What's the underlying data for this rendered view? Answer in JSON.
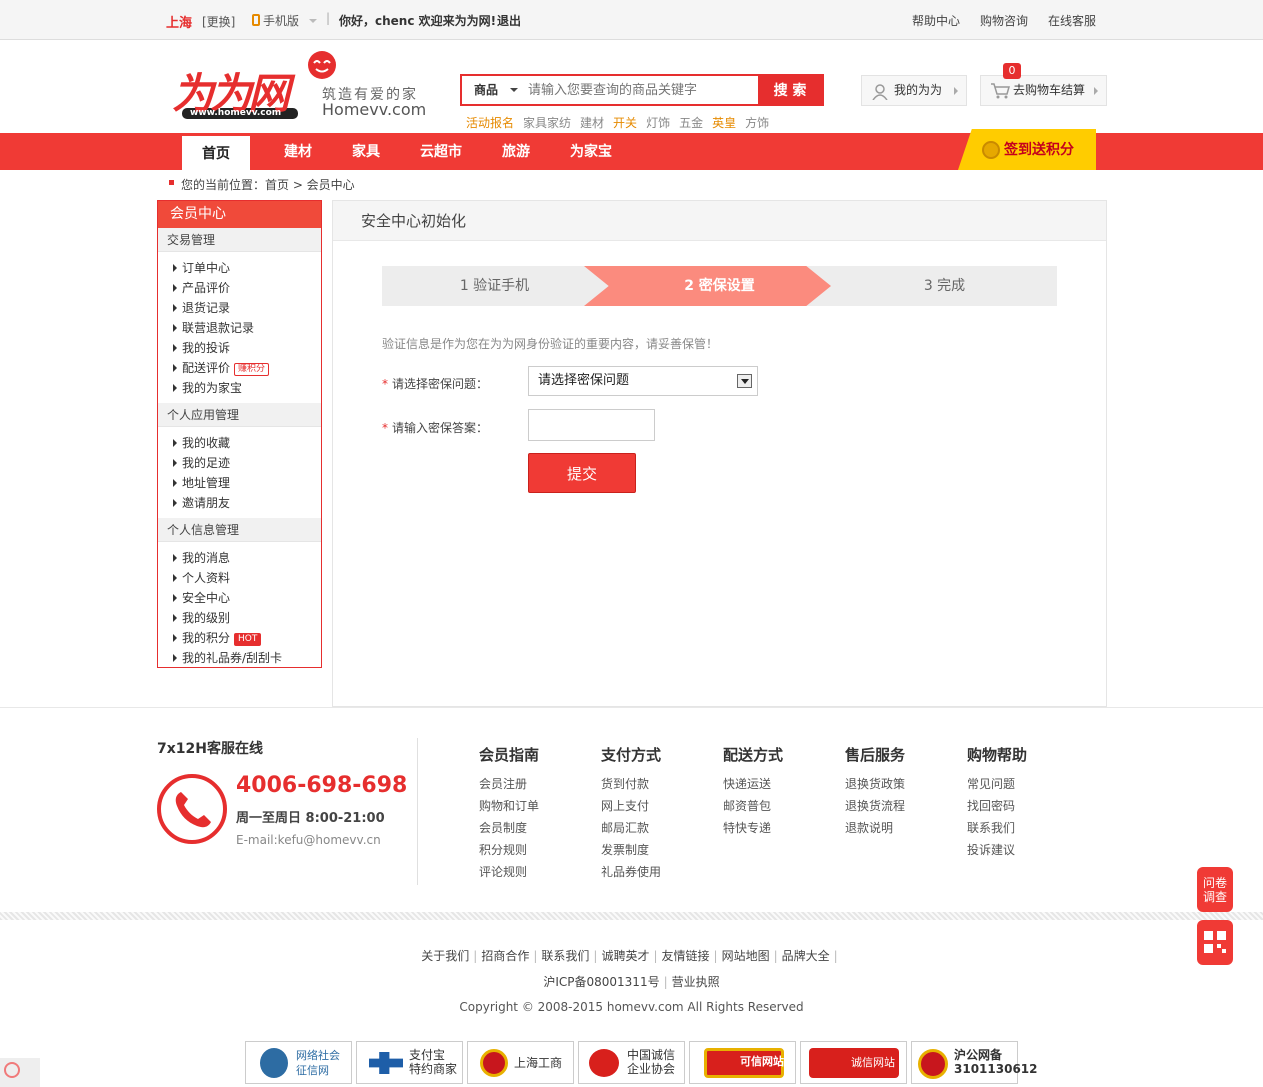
{
  "topbar": {
    "city": "上海",
    "change": "[更换]",
    "mobile": "手机版",
    "welcome": "你好，chenc 欢迎来为为网!",
    "logout": "退出",
    "help": "帮助中心",
    "consult": "购物咨询",
    "service": "在线客服"
  },
  "logo": {
    "brand": "为为网",
    "slogan": "筑造有爱的家",
    "domain": "Homevv.com",
    "url": "www.homevv.com"
  },
  "search": {
    "category": "商品",
    "placeholder": "请输入您要查询的商品关键字",
    "button": "搜 索",
    "hotwords": [
      "活动报名",
      "家具家纺",
      "建材",
      "开关",
      "灯饰",
      "五金",
      "英皇",
      "方饰"
    ]
  },
  "header_buttons": {
    "my": "我的为为",
    "cart": "去购物车结算",
    "cart_count": "0"
  },
  "nav": {
    "items": [
      "首页",
      "建材",
      "家具",
      "云超市",
      "旅游",
      "为家宝"
    ],
    "signin": "签到送积分"
  },
  "breadcrumb": "您的当前位置：首页 > 会员中心",
  "sidebar": {
    "title": "会员中心",
    "groups": [
      {
        "name": "交易管理",
        "links": [
          "订单中心",
          "产品评价",
          "退货记录",
          "联营退款记录",
          "我的投诉",
          "配送评价",
          "我的为家宝"
        ]
      },
      {
        "name": "个人应用管理",
        "links": [
          "我的收藏",
          "我的足迹",
          "地址管理",
          "邀请朋友"
        ]
      },
      {
        "name": "个人信息管理",
        "links": [
          "我的消息",
          "个人资料",
          "安全中心",
          "我的级别",
          "我的积分",
          "我的礼品券/刮刮卡"
        ]
      }
    ],
    "badge_earn": "赚积分",
    "badge_hot": "HOT"
  },
  "main": {
    "title": "安全中心初始化",
    "steps": [
      "1 验证手机",
      "2 密保设置",
      "3 完成"
    ],
    "tip": "验证信息是作为您在为为网身份验证的重要内容，请妥善保管！",
    "q_label": "请选择密保问题：",
    "q_value": "请选择密保问题",
    "a_label": "请输入密保答案：",
    "required": "*",
    "submit": "提交"
  },
  "footer": {
    "service_title": "7x12H客服在线",
    "hotline": "4006-698-698",
    "hours": "周一至周日 8:00-21:00",
    "email": "E-mail:kefu@homevv.cn",
    "columns": [
      {
        "title": "会员指南",
        "links": [
          "会员注册",
          "购物和订单",
          "会员制度",
          "积分规则",
          "评论规则"
        ]
      },
      {
        "title": "支付方式",
        "links": [
          "货到付款",
          "网上支付",
          "邮局汇款",
          "发票制度",
          "礼品券使用"
        ]
      },
      {
        "title": "配送方式",
        "links": [
          "快递运送",
          "邮资普包",
          "特快专递"
        ]
      },
      {
        "title": "售后服务",
        "links": [
          "退换货政策",
          "退换货流程",
          "退款说明"
        ]
      },
      {
        "title": "购物帮助",
        "links": [
          "常见问题",
          "找回密码",
          "联系我们",
          "投诉建议"
        ]
      }
    ],
    "links": [
      "关于我们",
      "招商合作",
      "联系我们",
      "诚聘英才",
      "友情链接",
      "网站地图",
      "品牌大全"
    ],
    "icp": "沪ICP备08001311号",
    "license": "营业执照",
    "copyright": "Copyright © 2008-2015 homevv.com All Rights Reserved",
    "certs": [
      "网络社会\n征信网",
      "支付宝\n特约商家",
      "上海工商",
      "中国诚信\n企业协会",
      "可信网站",
      "诚信网站",
      "沪公网备\n3101130612"
    ]
  },
  "float": {
    "survey": "问卷\n调查"
  },
  "colors": {
    "brand_red": "#e62e2e",
    "nav_red": "#f03a35",
    "step_active": "#fb8b7e",
    "signin_yellow": "#ffcc00"
  }
}
